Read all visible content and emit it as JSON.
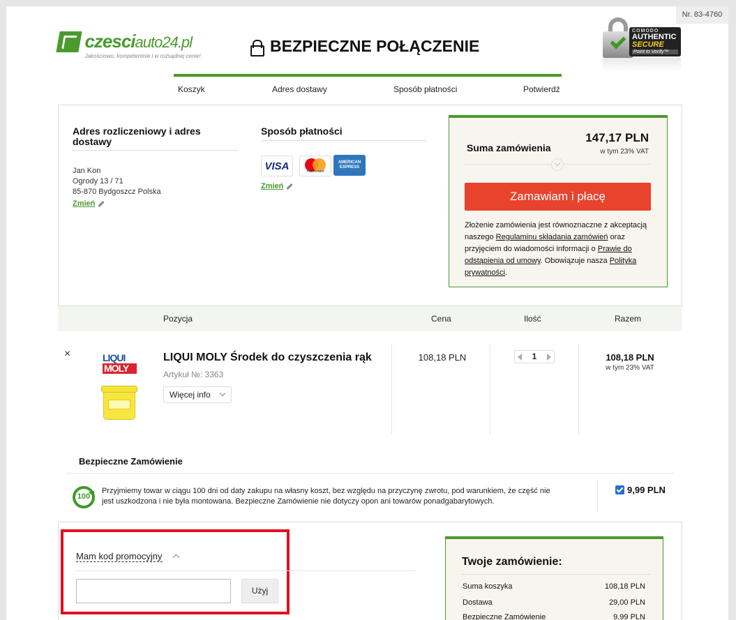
{
  "header": {
    "order_no": "Nr. 83-4760",
    "logo_main": "czesci",
    "logo_sub": "auto24.pl",
    "logo_tagline": "Jakościowo, kompetentnie i w rozsądnej cenie!",
    "secure_title": "BEZPIECZNE POŁĄCZENIE",
    "comodo": {
      "brand": "COMODO",
      "line1": "AUTHENTIC",
      "line2": "SECURE",
      "line3": "Point to Verify™"
    }
  },
  "steps": [
    "Koszyk",
    "Adres dostawy",
    "Sposób płatności",
    "Potwierdź"
  ],
  "billing": {
    "title": "Adres rozliczeniowy i adres dostawy",
    "name": "Jan Kon",
    "street": "Ogrody 13 / 71",
    "city": "85-870 Bydgoszcz Polska",
    "change": "Zmień"
  },
  "payment": {
    "title": "Sposób płatności",
    "cards": {
      "visa": "VISA",
      "mastercard": "mastercard",
      "amex_1": "AMERICAN",
      "amex_2": "EXPRESS"
    },
    "change": "Zmień"
  },
  "summary": {
    "label": "Suma zamówienia",
    "price": "147,17 PLN",
    "vat": "w tym 23% VAT",
    "button": "Zamawiam i płacę",
    "terms_1": "Złożenie zamówienia jest równoznaczne z akceptacją naszego ",
    "terms_link1": "Regulaminu składania zamówień",
    "terms_2": " oraz przyjęciem do wiadomości informacji o ",
    "terms_link2": "Prawie do odstąpienia od umowy",
    "terms_3": ". Obowiązuje nasza ",
    "terms_link3": "Polityka prywatności",
    "terms_4": "."
  },
  "table": {
    "headers": {
      "position": "Pozycja",
      "price": "Cena",
      "qty": "Ilość",
      "total": "Razem"
    }
  },
  "item": {
    "remove": "×",
    "brand_line1": "LIQUI",
    "brand_line2": "MOLY",
    "name": "LIQUI MOLY Środek do czyszczenia rąk",
    "article": "Artykuł №: 3363",
    "more": "Więcej info",
    "price": "108,18 PLN",
    "qty": "1",
    "total": "108,18 PLN",
    "total_vat": "w tym 23% VAT"
  },
  "safe_order": {
    "title": "Bezpieczne Zamówienie",
    "icon_text": "100",
    "text": "Przyjmiemy towar w ciągu 100 dni od daty zakupu na własny koszt, bez względu na przyczynę zwrotu, pod warunkiem, że część nie jest uszkodzona i nie była montowana. Bezpieczne Zamówienie nie dotyczy opon ani towarów ponadgabarytowych.",
    "price": "9,99 PLN",
    "checked": true
  },
  "promo": {
    "label": "Mam kod promocyjny",
    "value": "",
    "button": "Użyj"
  },
  "your_order": {
    "title": "Twoje zamówienie:",
    "rows": [
      {
        "label": "Suma koszyka",
        "value": "108,18 PLN"
      },
      {
        "label": "Dostawa",
        "value": "29,00 PLN"
      },
      {
        "label": "Bezpieczne Zamówienie",
        "value": "9,99 PLN"
      }
    ]
  },
  "colors": {
    "brand_green": "#4a9a2e",
    "order_button": "#e8432d",
    "highlight": "#e01020",
    "checkbox": "#2a6fd1"
  }
}
